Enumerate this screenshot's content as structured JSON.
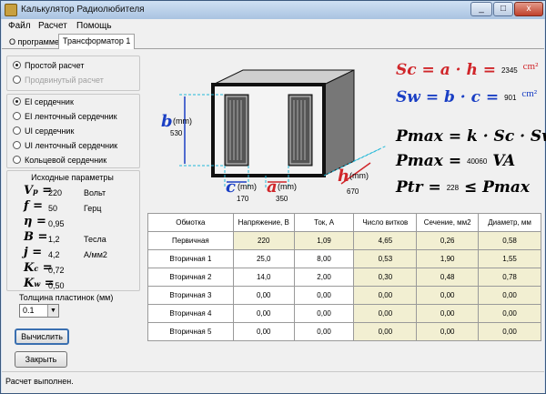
{
  "window": {
    "title": "Калькулятор Радиолюбителя",
    "controls": [
      "_",
      "□",
      "x"
    ]
  },
  "menu": [
    "Файл",
    "Расчет",
    "Помощь"
  ],
  "tabs": [
    {
      "label": "О программе"
    },
    {
      "label": "Трансформатор 1"
    }
  ],
  "calc_mode": {
    "simple": "Простой расчет",
    "advanced": "Продвинутый расчет",
    "selected": "simple"
  },
  "core_types": {
    "items": [
      "EI сердечник",
      "EI ленточный сердечник",
      "UI сердечник",
      "UI ленточный сердечник",
      "Кольцевой сердечник"
    ],
    "selected_index": 0
  },
  "params": {
    "title": "Исходные параметры",
    "vp": {
      "value": "220",
      "unit": "Вольт"
    },
    "f": {
      "value": "50",
      "unit": "Герц"
    },
    "eta": {
      "value": "0,95",
      "unit": ""
    },
    "b": {
      "value": "1,2",
      "unit": "Тесла"
    },
    "j": {
      "value": "4,2",
      "unit": "А/мм2"
    },
    "kc": {
      "value": "0,72",
      "unit": ""
    },
    "kw": {
      "value": "0,50",
      "unit": ""
    }
  },
  "plate": {
    "label": "Толщина пластинок (мм)",
    "value": "0.1"
  },
  "buttons": {
    "calculate": "Вычислить",
    "close": "Закрыть"
  },
  "diagram": {
    "b_label": "b",
    "b_unit": "(mm)",
    "b_value": "530",
    "c_label": "c",
    "c_unit": "(mm)",
    "c_value": "170",
    "a_label": "a",
    "a_unit": "(mm)",
    "a_value": "350",
    "h_label": "h",
    "h_unit": "(mm)",
    "h_value": "670"
  },
  "formulas": {
    "sc": {
      "text": "Sc = a · h =",
      "value": "2345",
      "unit": "cm²"
    },
    "sw": {
      "text": "Sw = b · c =",
      "value": "901",
      "unit": "cm²"
    },
    "pmax_formula": "Pmax = k · Sc · Sw",
    "pmax": {
      "text": "Pmax =",
      "value": "40060",
      "unit": "VA"
    },
    "ptr": {
      "text": "Ptr =",
      "value": "228",
      "tail": "≤ Pmax"
    }
  },
  "table": {
    "headers": [
      "Обмотка",
      "Напряжение, В",
      "Ток, А",
      "Число витков",
      "Сечение, мм2",
      "Диаметр, мм"
    ],
    "rows": [
      [
        "Первичная",
        "220",
        "1,09",
        "4,65",
        "0,26",
        "0,58"
      ],
      [
        "Вторичная 1",
        "25,0",
        "8,00",
        "0,53",
        "1,90",
        "1,55"
      ],
      [
        "Вторичная 2",
        "14,0",
        "2,00",
        "0,30",
        "0,48",
        "0,78"
      ],
      [
        "Вторичная 3",
        "0,00",
        "0,00",
        "0,00",
        "0,00",
        "0,00"
      ],
      [
        "Вторичная 4",
        "0,00",
        "0,00",
        "0,00",
        "0,00",
        "0,00"
      ],
      [
        "Вторичная 5",
        "0,00",
        "0,00",
        "0,00",
        "0,00",
        "0,00"
      ]
    ]
  },
  "status": "Расчет выполнен.",
  "colors": {
    "red": "#d0262a",
    "blue": "#1a3fc4",
    "cyan": "#22b8d8",
    "readonly": "#f2efd2"
  }
}
